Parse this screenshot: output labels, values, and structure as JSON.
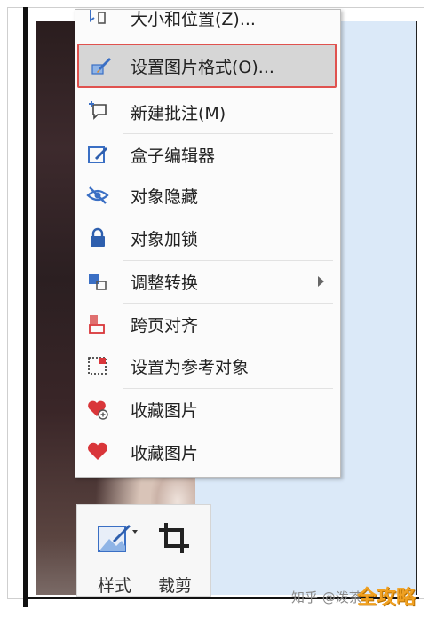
{
  "context_menu": {
    "items": [
      {
        "label": "大小和位置(Z)...",
        "icon": "size-position-icon"
      },
      {
        "label": "设置图片格式(O)...",
        "icon": "format-picture-icon",
        "highlighted": true
      },
      {
        "label": "新建批注(M)",
        "icon": "new-comment-icon"
      },
      {
        "label": "盒子编辑器",
        "icon": "edit-box-icon"
      },
      {
        "label": "对象隐藏",
        "icon": "hide-eye-icon"
      },
      {
        "label": "对象加锁",
        "icon": "lock-icon"
      },
      {
        "label": "调整转换",
        "icon": "adjust-convert-icon",
        "has_submenu": true
      },
      {
        "label": "跨页对齐",
        "icon": "cross-page-align-icon"
      },
      {
        "label": "设置为参考对象",
        "icon": "reference-object-icon"
      },
      {
        "label": "收藏图片",
        "icon": "favorite-add-icon"
      },
      {
        "label": "收藏图片",
        "icon": "favorite-heart-icon"
      }
    ]
  },
  "toolbar": {
    "style_label": "样式",
    "crop_label": "裁剪"
  },
  "watermark": {
    "text": "知乎 @泼茶",
    "logo": "全攻略"
  },
  "colors": {
    "highlight_border": "#e0524f",
    "icon_blue": "#3a6fc4",
    "icon_red": "#d9363a",
    "doc_background": "#dbe9f8"
  }
}
